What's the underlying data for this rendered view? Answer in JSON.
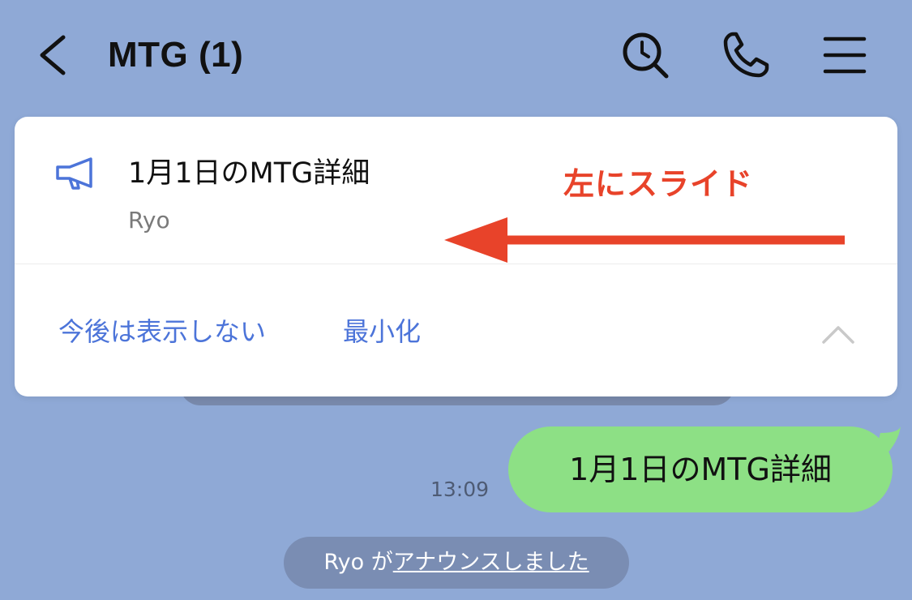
{
  "header": {
    "title": "MTG (1)",
    "icons": [
      "chevron-left-icon",
      "search-clock-icon",
      "phone-icon",
      "menu-icon"
    ]
  },
  "announcement": {
    "title": "1月1日のMTG詳細",
    "author": "Ryo",
    "annotation": "左にスライド",
    "actions": {
      "hide_label": "今後は表示しない",
      "minimize_label": "最小化"
    }
  },
  "chat": {
    "message": {
      "text": "1月1日のMTG詳細",
      "time": "13:09"
    },
    "system": {
      "prefix": "Ryo が",
      "link": "アナウンスしました"
    }
  },
  "colors": {
    "background": "#8fa9d6",
    "accent_link": "#4c74d9",
    "annotation_red": "#e8432a",
    "bubble_green": "#8de085",
    "card": "#ffffff"
  }
}
